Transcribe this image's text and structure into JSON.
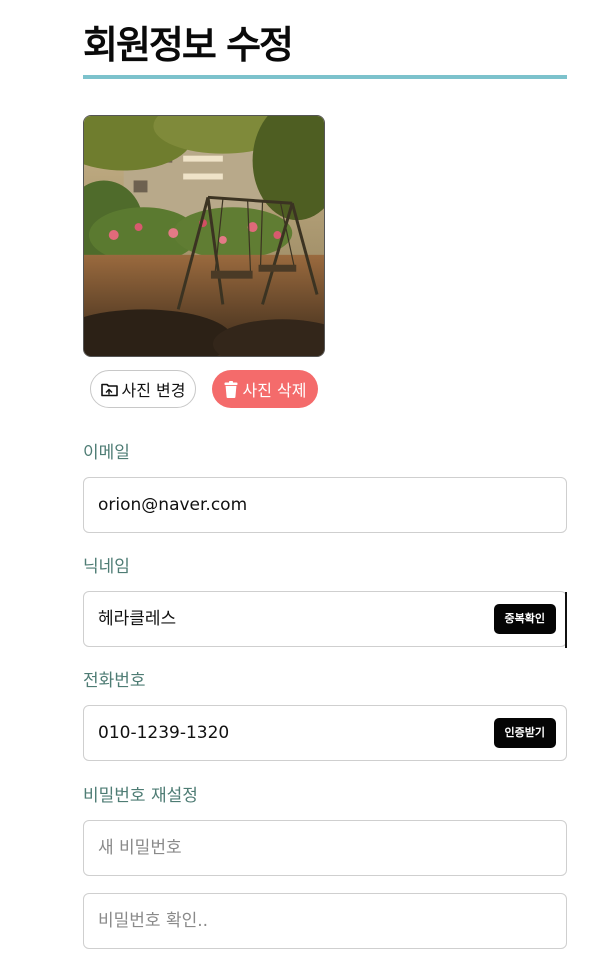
{
  "page": {
    "title": "회원정보 수정"
  },
  "photo": {
    "change_label": "사진 변경",
    "delete_label": "사진 삭제",
    "colors": {
      "delete_bg": "#f46b6b",
      "accent_rule": "#7cc2cc"
    }
  },
  "email": {
    "label": "이메일",
    "value": "orion@naver.com"
  },
  "nickname": {
    "label": "닉네임",
    "value": "헤라클레스",
    "action_label": "중복확인"
  },
  "phone": {
    "label": "전화번호",
    "value": "010-1239-1320",
    "action_label": "인증받기"
  },
  "password": {
    "label": "비밀번호 재설정",
    "new_placeholder": "새 비밀번호",
    "confirm_placeholder": "비밀번호 확인.."
  }
}
